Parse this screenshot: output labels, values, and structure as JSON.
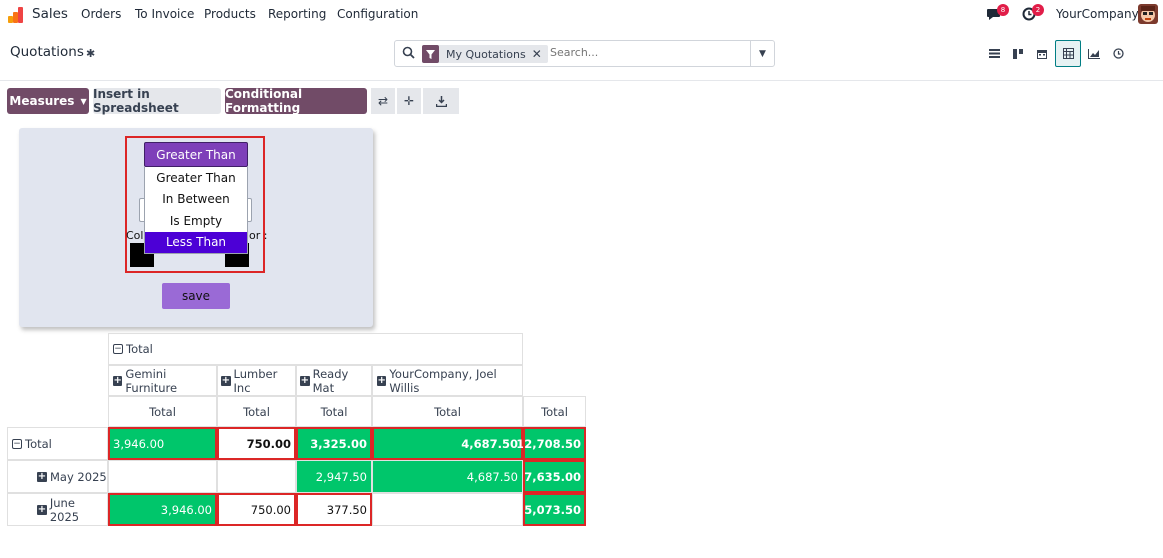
{
  "nav": {
    "app_name": "Sales",
    "menu": [
      "Orders",
      "To Invoice",
      "Products",
      "Reporting",
      "Configuration"
    ],
    "chat_badge": "8",
    "activity_badge": "2",
    "company": "YourCompany"
  },
  "control": {
    "breadcrumb": "Quotations",
    "facet_label": "My Quotations",
    "search_placeholder": "Search...",
    "views": [
      "list-icon",
      "kanban-icon",
      "calendar-icon",
      "pivot-icon",
      "graph-icon",
      "activity-icon"
    ],
    "active_view": "pivot-icon"
  },
  "toolbar": {
    "measures_label": "Measures",
    "insert_label": "Insert in Spreadsheet",
    "cond_format_label": "Conditional Formatting",
    "icons": [
      "flip-axis-icon",
      "expand-all-icon",
      "download-icon"
    ]
  },
  "cf_panel": {
    "selected_condition": "Greater Than",
    "options": [
      "Greater Than",
      "In Between",
      "Is Empty",
      "Less Than"
    ],
    "highlighted_option": "Less Than",
    "color_label_left": "Col",
    "color_label_right": "lor :",
    "save_label": "save",
    "swatch_colors": [
      "#000000",
      "#000000"
    ]
  },
  "pivot": {
    "top_header": "Total",
    "columns": [
      "Gemini Furniture",
      "Lumber Inc",
      "Ready Mat",
      "YourCompany, Joel Willis"
    ],
    "measure_header": "Total",
    "rows": [
      {
        "label": "Total",
        "values": [
          "3,946.00",
          "750.00",
          "3,325.00",
          "4,687.50",
          "12,708.50"
        ]
      },
      {
        "label": "May 2025",
        "values": [
          "",
          "",
          "2,947.50",
          "4,687.50",
          "7,635.00"
        ]
      },
      {
        "label": "June 2025",
        "values": [
          "3,946.00",
          "750.00",
          "377.50",
          "",
          "5,073.50"
        ]
      }
    ],
    "highlight_color": "#00c66b"
  }
}
